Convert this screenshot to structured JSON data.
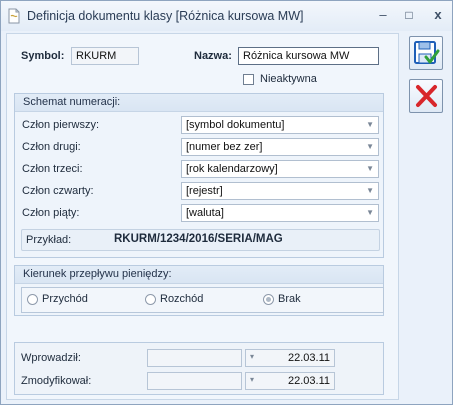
{
  "window": {
    "title": "Definicja dokumentu klasy [Różnica kursowa MW]",
    "minimize": "–",
    "maximize": "□",
    "close": "x"
  },
  "header": {
    "symbol_label": "Symbol:",
    "symbol_value": "RKURM",
    "name_label": "Nazwa:",
    "name_value": "Różnica kursowa MW",
    "inactive_label": "Nieaktywna"
  },
  "numbering": {
    "title": "Schemat numeracji:",
    "rows": [
      {
        "label": "Człon pierwszy:",
        "value": "[symbol dokumentu]"
      },
      {
        "label": "Człon drugi:",
        "value": "[numer bez zer]"
      },
      {
        "label": "Człon trzeci:",
        "value": "[rok kalendarzowy]"
      },
      {
        "label": "Człon czwarty:",
        "value": "[rejestr]"
      },
      {
        "label": "Człon piąty:",
        "value": "[waluta]"
      }
    ],
    "example_label": "Przykład:",
    "example_value": "RKURM/1234/2016/SERIA/MAG"
  },
  "cashflow": {
    "title": "Kierunek przepływu pieniędzy:",
    "options": [
      "Przychód",
      "Rozchód",
      "Brak"
    ],
    "selected": "Brak"
  },
  "audit": {
    "created_label": "Wprowadził:",
    "created_date": "22.03.11",
    "modified_label": "Zmodyfikował:",
    "modified_date": "22.03.11"
  },
  "colors": {
    "save_accent": "#1f5fb8",
    "save_check": "#2fa03a",
    "cancel_red": "#d8262b"
  },
  "icons": [
    "document-icon",
    "save-icon",
    "cancel-icon"
  ]
}
